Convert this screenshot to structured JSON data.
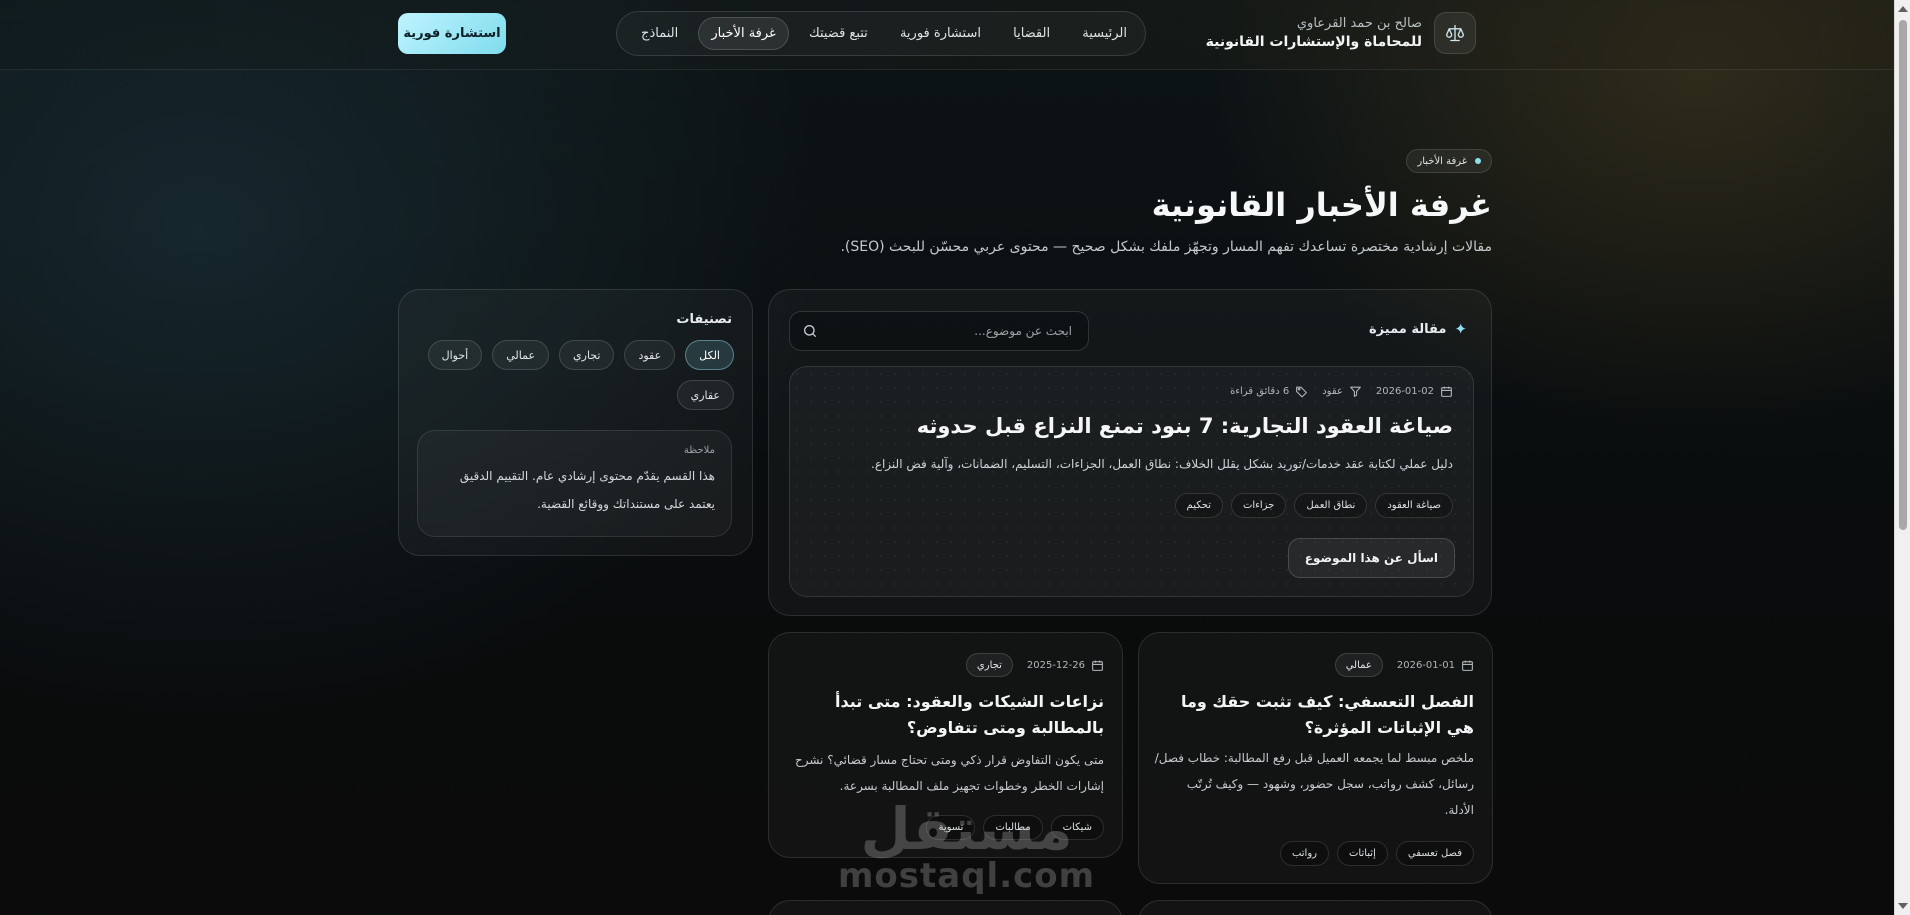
{
  "header": {
    "brand_sub": "صالح بن حمد القرعاوي",
    "brand_name": "للمحاماة والإستشارات القانونية",
    "logo_icon": "scales-icon",
    "nav": [
      "الرئيسية",
      "القضايا",
      "استشارة فورية",
      "تتبع قضيتك",
      "غرفة الأخبار",
      "النماذج"
    ],
    "active_nav": "غرفة الأخبار",
    "cta": "استشارة فورية"
  },
  "hero": {
    "badge": "غرفة الأخبار",
    "title": "غرفة الأخبار القانونية",
    "subtitle": "مقالات إرشادية مختصرة تساعدك تفهم المسار وتجهّز ملفك بشكل صحيح — محتوى عربي محسّن للبحث (SEO)."
  },
  "sidebar": {
    "title": "تصنيفات",
    "categories": [
      "الكل",
      "عقود",
      "تجاري",
      "عمالي",
      "أحوال",
      "عقاري"
    ],
    "active_category": "الكل",
    "note_label": "ملاحظة",
    "note_text": "هذا القسم يقدّم محتوى إرشادي عام. التقييم الدقيق يعتمد على مستنداتك ووقائع القضية."
  },
  "featured": {
    "label": "مقالة مميزة",
    "search_placeholder": "ابحث عن موضوع...",
    "date": "2026-01-02",
    "category": "عقود",
    "read_time": "6 دقائق قراءة",
    "title": "صياغة العقود التجارية: 7 بنود تمنع النزاع قبل حدوثه",
    "description": "دليل عملي لكتابة عقد خدمات/توريد بشكل يقلل الخلاف: نطاق العمل، الجزاءات، التسليم، الضمانات، وآلية فض النزاع.",
    "tags": [
      "صياغة العقود",
      "نطاق العمل",
      "جزاءات",
      "تحكيم"
    ],
    "ask_button": "اسأل عن هذا الموضوع"
  },
  "articles": [
    {
      "date": "2026-01-01",
      "category": "عمالي",
      "title": "الفصل التعسفي: كيف تثبت حقك وما هي الإثباتات المؤثرة؟",
      "description": "ملخص مبسط لما يجمعه العميل قبل رفع المطالبة: خطاب فصل/رسائل، كشف رواتب، سجل حضور، وشهود — وكيف تُرتّب الأدلة.",
      "tags": [
        "فصل تعسفي",
        "إثباتات",
        "رواتب"
      ]
    },
    {
      "date": "2025-12-26",
      "category": "تجاري",
      "title": "نزاعات الشيكات والعقود: متى تبدأ بالمطالبة ومتى تتفاوض؟",
      "description": "متى يكون التفاوض قرار ذكي ومتى تحتاج مسار قضائي؟ نشرح إشارات الخطر وخطوات تجهيز ملف المطالبة بسرعة.",
      "tags": [
        "شيكات",
        "مطالبات",
        "تسوية"
      ]
    }
  ],
  "watermark": {
    "ar": "مستقل",
    "en": "mostaql.com"
  },
  "colors": {
    "accent": "#8ee0f0",
    "cta_bg": "#bff3ff",
    "background": "#0b0d0e"
  }
}
